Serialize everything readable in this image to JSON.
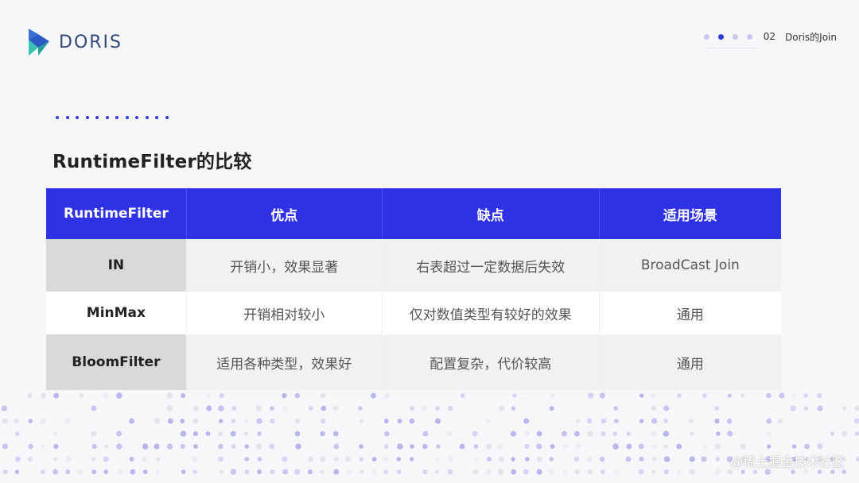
{
  "header": {
    "logo_text": "DORIS",
    "page_number": "02",
    "section_label": "Doris的Join",
    "pager_dots": 4,
    "pager_active_index": 1
  },
  "title": "RuntimeFilter的比较",
  "table": {
    "headers": [
      "RuntimeFilter",
      "优点",
      "缺点",
      "适用场景"
    ],
    "rows": [
      [
        "IN",
        "开销小，效果显著",
        "右表超过一定数据后失效",
        "BroadCast Join"
      ],
      [
        "MinMax",
        "开销相对较小",
        "仅对数值类型有较好的效果",
        "通用"
      ],
      [
        "BloomFilter",
        "适用各种类型，效果好",
        "配置复杂，代价较高",
        "通用"
      ]
    ]
  },
  "watermark": "@稀土掘金技术社区",
  "colors": {
    "accent": "#2f32e4",
    "logo_blue": "#2f4a7a",
    "dot_light": "#c9c9f0"
  }
}
